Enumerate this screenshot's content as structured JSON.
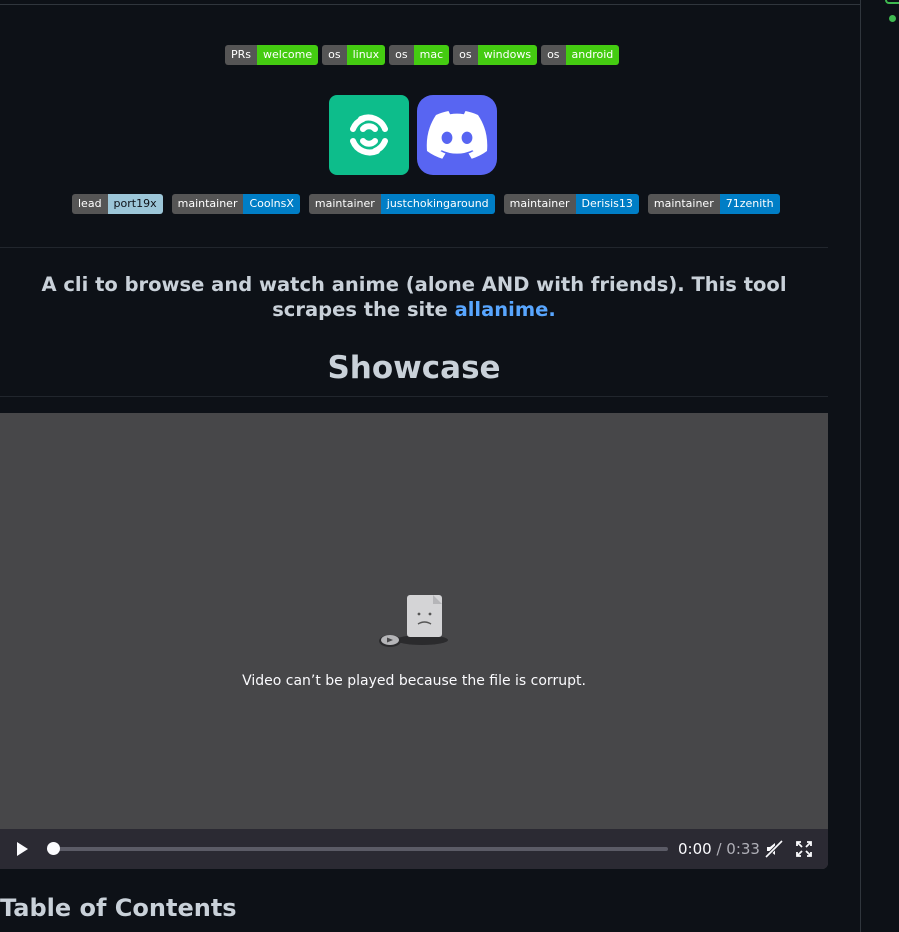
{
  "badges_row1": [
    {
      "key": "PRs",
      "value": "welcome"
    },
    {
      "key": "os",
      "value": "linux"
    },
    {
      "key": "os",
      "value": "mac"
    },
    {
      "key": "os",
      "value": "windows"
    },
    {
      "key": "os",
      "value": "android"
    }
  ],
  "badges_row2": [
    {
      "key": "lead",
      "value": "port19x"
    },
    {
      "key": "maintainer",
      "value": "CoolnsX"
    },
    {
      "key": "maintainer",
      "value": "justchokingaround"
    },
    {
      "key": "maintainer",
      "value": "Derisis13"
    },
    {
      "key": "maintainer",
      "value": "71zenith"
    }
  ],
  "logos": {
    "element_icon": "element-icon",
    "discord_icon": "discord-icon"
  },
  "description": {
    "text": "A cli to browse and watch anime (alone AND with friends). This tool scrapes the site ",
    "link_text": "allanime."
  },
  "showcase_heading": "Showcase",
  "video": {
    "error_text": "Video can’t be played because the file is corrupt.",
    "current_time": "0:00",
    "separator": " / ",
    "duration": "0:33",
    "progress": 0.0
  },
  "toc_heading": "Table of Contents",
  "colors": {
    "badge_green": "#44cc11",
    "badge_blue": "#007ec6",
    "link": "#58a6ff",
    "bg": "#0d1117"
  }
}
